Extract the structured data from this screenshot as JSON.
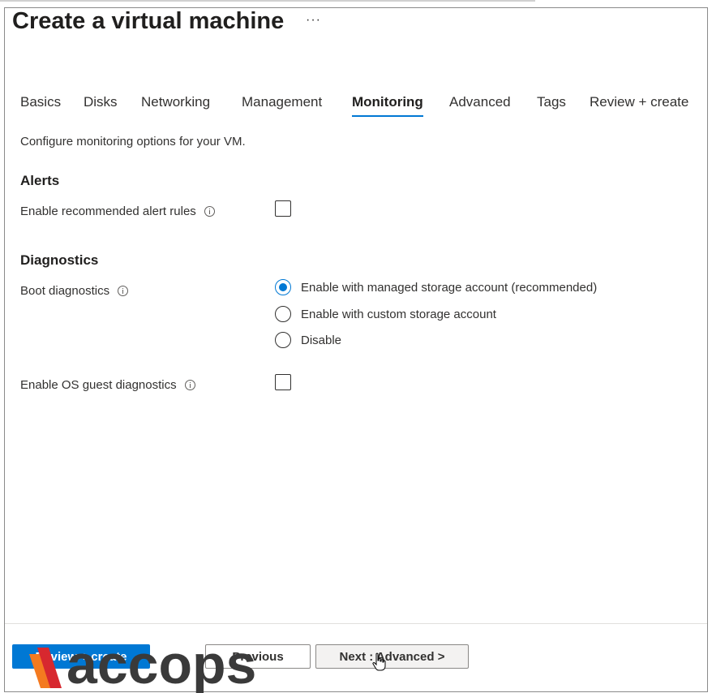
{
  "header": {
    "title": "Create a virtual machine",
    "more_label": "···"
  },
  "tabs": [
    {
      "label": "Basics",
      "active": false
    },
    {
      "label": "Disks",
      "active": false
    },
    {
      "label": "Networking",
      "active": false
    },
    {
      "label": "Management",
      "active": false
    },
    {
      "label": "Monitoring",
      "active": true
    },
    {
      "label": "Advanced",
      "active": false
    },
    {
      "label": "Tags",
      "active": false
    },
    {
      "label": "Review + create",
      "active": false
    }
  ],
  "intro": "Configure monitoring options for your VM.",
  "alerts": {
    "heading": "Alerts",
    "recommended_rules_label": "Enable recommended alert rules",
    "recommended_rules_checked": false
  },
  "diagnostics": {
    "heading": "Diagnostics",
    "boot_label": "Boot diagnostics",
    "boot_options": [
      {
        "label": "Enable with managed storage account (recommended)",
        "selected": true
      },
      {
        "label": "Enable with custom storage account",
        "selected": false
      },
      {
        "label": "Disable",
        "selected": false
      }
    ],
    "guest_label": "Enable OS guest diagnostics",
    "guest_checked": false
  },
  "footer": {
    "review_create_label": "Review + create",
    "previous_label": "Previous",
    "next_label": "Next : Advanced >"
  },
  "watermark": {
    "text": "accops"
  },
  "colors": {
    "accent": "#0078d4",
    "watermark_orange": "#f47a20",
    "watermark_red": "#d7282f",
    "watermark_dark": "#3a3a3a"
  },
  "icons": {
    "info": "info-circle-icon",
    "more": "ellipsis-icon",
    "cursor": "hand-pointer-icon"
  }
}
